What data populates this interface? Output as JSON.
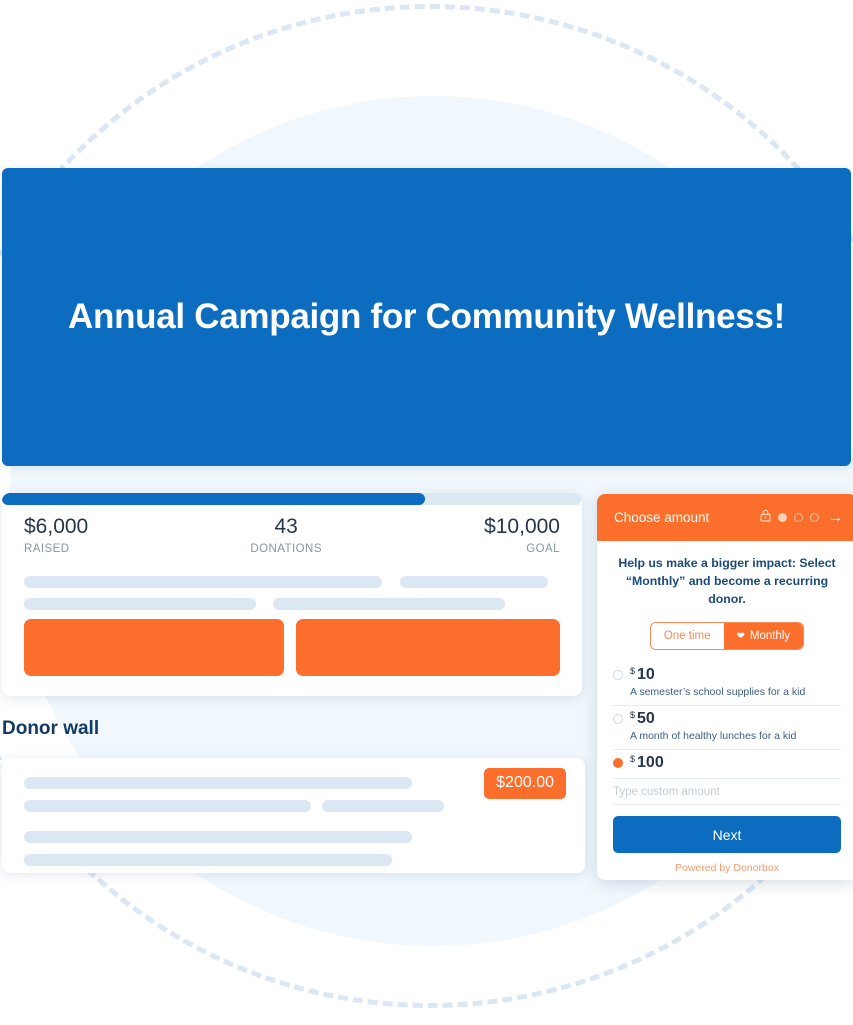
{
  "hero": {
    "title": "Annual Campaign for Community Wellness!",
    "background_color": "#0b6cc0"
  },
  "stats": {
    "progress_percent": 73,
    "raised": {
      "value": "$6,000",
      "label": "RAISED"
    },
    "donations": {
      "value": "43",
      "label": "DONATIONS"
    },
    "goal": {
      "value": "$10,000",
      "label": "GOAL"
    },
    "accent_color": "#fb6e2b"
  },
  "donor_wall": {
    "title": "Donor wall",
    "entries": [
      {
        "amount": "$200.00"
      }
    ]
  },
  "form": {
    "header": {
      "title": "Choose amount",
      "lock_icon": "lock-icon",
      "steps": [
        {
          "state": "active"
        },
        {
          "state": "inactive"
        },
        {
          "state": "inactive"
        }
      ],
      "arrow_icon": "arrow-right-icon",
      "background_color": "#fb6e2b"
    },
    "impact_message": "Help us make a bigger impact: Select “Monthly” and become a recurring donor.",
    "frequency": {
      "options": [
        {
          "label": "One time",
          "selected": false
        },
        {
          "label": "Monthly",
          "selected": true,
          "icon": "heart-icon"
        }
      ]
    },
    "amounts": [
      {
        "currency": "$",
        "value": "10",
        "description": "A semester’s school supplies for a kid",
        "selected": false
      },
      {
        "currency": "$",
        "value": "50",
        "description": "A month of healthy lunches for a kid",
        "selected": false
      },
      {
        "currency": "$",
        "value": "100",
        "description": "",
        "selected": true
      }
    ],
    "custom_amount": {
      "placeholder": "Type custom amount",
      "value": ""
    },
    "next_button": "Next",
    "powered_by": "Powered by Donorbox"
  }
}
